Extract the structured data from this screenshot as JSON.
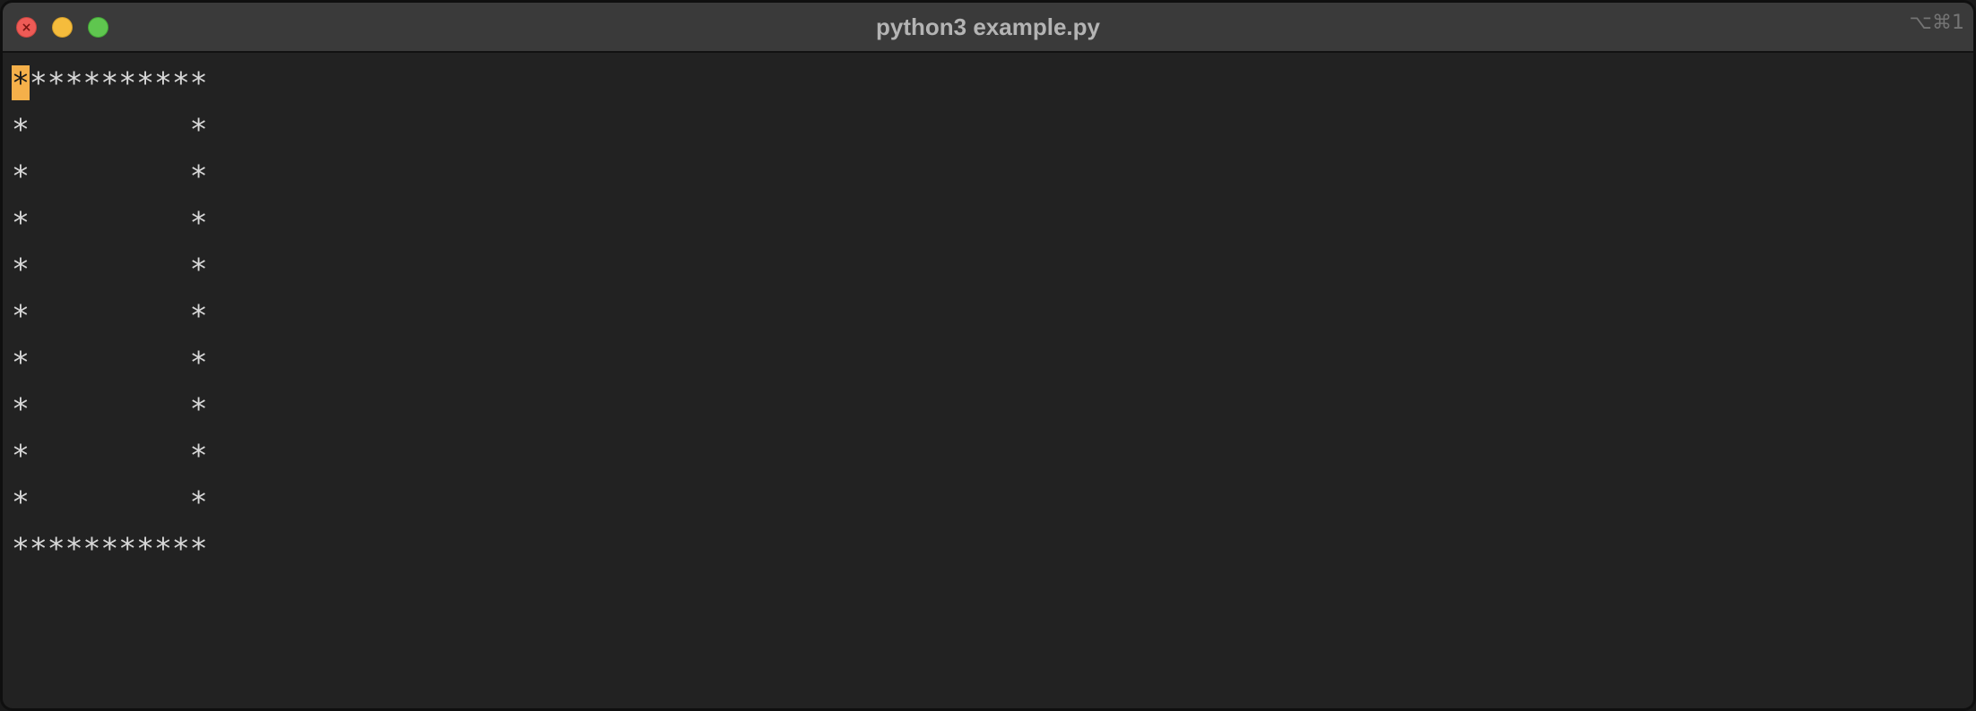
{
  "window": {
    "title": "python3 example.py",
    "shortcut": "⌥⌘1"
  },
  "terminal": {
    "cursor_char": "*",
    "first_line_rest": "**********",
    "lines": [
      "*         *",
      "*         *",
      "*         *",
      "*         *",
      "*         *",
      "*         *",
      "*         *",
      "*         *",
      "*         *",
      "***********"
    ]
  },
  "colors": {
    "cursor": "#f5b04a",
    "background": "#222222",
    "foreground": "#d8d8d8",
    "close": "#ee5b56",
    "minimize": "#f5bc3c",
    "maximize": "#5fc64f"
  }
}
